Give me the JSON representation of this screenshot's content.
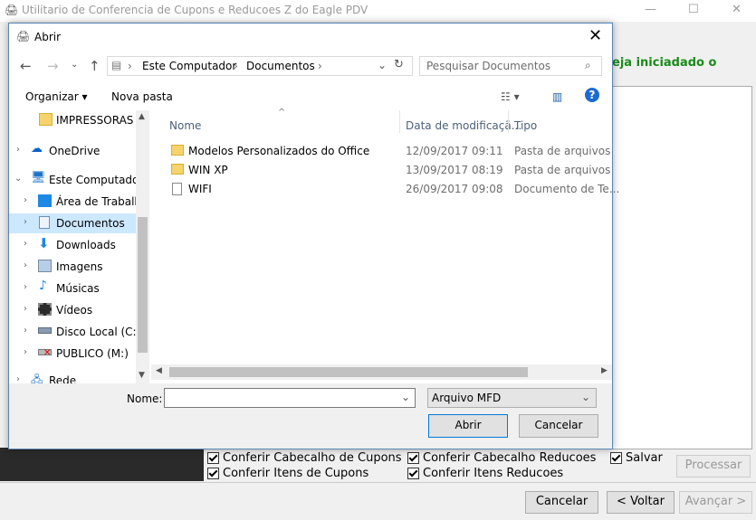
{
  "main_window": {
    "title": "Utilitario de Conferencia de Cupons e Reducoes Z do Eagle PDV",
    "message": "eja iniciadado o",
    "checkboxes": [
      {
        "label": "Conferir Cabecalho de Cupons",
        "checked": true
      },
      {
        "label": "Conferir Cabecalho Reducoes",
        "checked": true
      },
      {
        "label": "Salvar",
        "checked": true
      },
      {
        "label": "Conferir Itens de Cupons",
        "checked": true
      },
      {
        "label": "Conferir Itens Reducoes",
        "checked": true
      }
    ],
    "process_button": "Processar",
    "cancel_button": "Cancelar",
    "back_button": "< Voltar",
    "next_button": "Avançar >",
    "minimize": "—",
    "maximize": "☐",
    "close": "✕"
  },
  "dialog": {
    "title": "Abrir",
    "close": "✕",
    "breadcrumb": [
      "Este Computador",
      "Documentos"
    ],
    "search_placeholder": "Pesquisar Documentos",
    "toolbar": {
      "organize": "Organizar ▾",
      "new_folder": "Nova pasta"
    },
    "nav_items": [
      {
        "label": "IMPRESSORAS",
        "icon": "folder-icon",
        "selected": false,
        "arrow": ""
      },
      {
        "label": "OneDrive",
        "icon": "onedrive-icon",
        "selected": false,
        "arrow": "›"
      },
      {
        "label": "Este Computador",
        "icon": "computer-icon",
        "selected": false,
        "arrow": "⌄"
      },
      {
        "label": "Área de Trabalho",
        "icon": "desktop-icon",
        "selected": false,
        "arrow": "›"
      },
      {
        "label": "Documentos",
        "icon": "documents-icon",
        "selected": true,
        "arrow": "›"
      },
      {
        "label": "Downloads",
        "icon": "downloads-icon",
        "selected": false,
        "arrow": "›"
      },
      {
        "label": "Imagens",
        "icon": "pictures-icon",
        "selected": false,
        "arrow": "›"
      },
      {
        "label": "Músicas",
        "icon": "music-icon",
        "selected": false,
        "arrow": "›"
      },
      {
        "label": "Vídeos",
        "icon": "videos-icon",
        "selected": false,
        "arrow": "›"
      },
      {
        "label": "Disco Local (C:)",
        "icon": "drive-icon",
        "selected": false,
        "arrow": "›"
      },
      {
        "label": "PUBLICO (M:)",
        "icon": "network-drive-icon",
        "selected": false,
        "arrow": "›"
      },
      {
        "label": "Rede",
        "icon": "network-icon",
        "selected": false,
        "arrow": "›"
      }
    ],
    "columns": [
      "Nome",
      "Data de modificaçã...",
      "Tipo"
    ],
    "files": [
      {
        "name": "Modelos Personalizados do Office",
        "date": "12/09/2017 09:11",
        "type": "Pasta de arquivos",
        "icon": "folder-icon"
      },
      {
        "name": "WIN XP",
        "date": "13/09/2017 08:19",
        "type": "Pasta de arquivos",
        "icon": "folder-icon"
      },
      {
        "name": "WIFI",
        "date": "26/09/2017 09:08",
        "type": "Documento de Te...",
        "icon": "text-file-icon"
      }
    ],
    "name_label": "Nome:",
    "name_value": "",
    "file_type": "Arquivo MFD",
    "open_button": "Abrir",
    "cancel_button": "Cancelar",
    "colors": {
      "accent": "#0078d7",
      "selection": "#cce8ff"
    }
  }
}
